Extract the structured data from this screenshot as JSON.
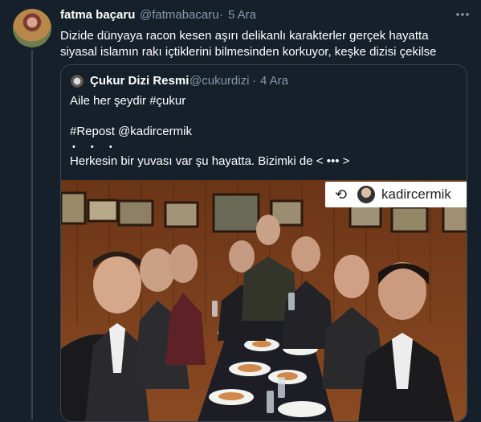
{
  "tweet": {
    "author_name": "fatma baçaru",
    "author_handle": "@fatmabacaru",
    "separator": "·",
    "time": "5 Ara",
    "more_icon": "more-horizontal-icon",
    "text": "Dizide dünyaya racon kesen aşırı delikanlı karakterler gerçek hayatta siyasal islamın rakı içtiklerini bilmesinden korkuyor, keşke dizisi çekilse"
  },
  "quote": {
    "author_name": "Çukur Dizi Resmi",
    "author_handle": "@cukurdizi",
    "separator": "·",
    "time": "4 Ara",
    "line1": "Aile her şeydir #çukur",
    "line2": "#Repost @kadircermik",
    "dots": "• • •",
    "line3": "Herkesin bir yuvası var şu hayatta. Bizimki de < ••• >",
    "photo": {
      "repost_label": "kadircermik",
      "repost_icon": "repost-icon"
    }
  }
}
